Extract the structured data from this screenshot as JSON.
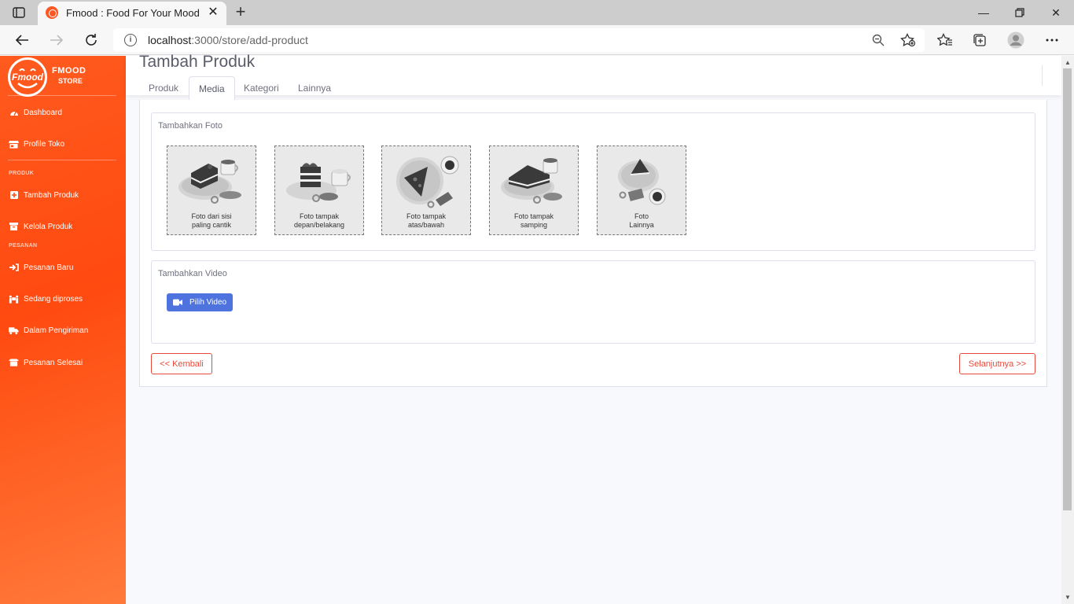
{
  "browser": {
    "tab_title": "Fmood : Food For Your Mood",
    "url_host": "localhost",
    "url_path": ":3000/store/add-product"
  },
  "sidebar": {
    "brand_logo_text": "Fmood",
    "brand_name": "FMOOD",
    "brand_sub": "STORE",
    "items": [
      {
        "label": "Dashboard",
        "icon": "tachometer-icon"
      },
      {
        "label": "Profile Toko",
        "icon": "store-icon"
      }
    ],
    "heading_produk": "PRODUK",
    "produk_items": [
      {
        "label": "Tambah Produk",
        "icon": "plus-square-icon"
      },
      {
        "label": "Kelola Produk",
        "icon": "archive-icon"
      }
    ],
    "heading_pesanan": "PESANAN",
    "pesanan_items": [
      {
        "label": "Pesanan Baru",
        "icon": "sign-in-icon"
      },
      {
        "label": "Sedang diproses",
        "icon": "people-carry-icon"
      },
      {
        "label": "Dalam Pengiriman",
        "icon": "truck-icon"
      },
      {
        "label": "Pesanan Selesai",
        "icon": "box-open-icon"
      }
    ]
  },
  "main": {
    "title": "Tambah Produk",
    "tabs": [
      "Produk",
      "Media",
      "Kategori",
      "Lainnya"
    ],
    "active_tab": "Media",
    "foto_section_title": "Tambahkan Foto",
    "photos": [
      {
        "line1": "Foto dari sisi",
        "line2": "paling cantik"
      },
      {
        "line1": "Foto tampak",
        "line2": "depan/belakang"
      },
      {
        "line1": "Foto tampak",
        "line2": "atas/bawah"
      },
      {
        "line1": "Foto tampak",
        "line2": "samping"
      },
      {
        "line1": "Foto",
        "line2": "Lainnya"
      }
    ],
    "video_section_title": "Tambahkan Video",
    "video_button": "Pilih Video",
    "back_button": "<< Kembali",
    "next_button": "Selanjutnya >>"
  },
  "colors": {
    "sidebar_accent": "#ff4a10",
    "primary_button": "#4e73df",
    "danger_outline": "#e74a3b"
  }
}
